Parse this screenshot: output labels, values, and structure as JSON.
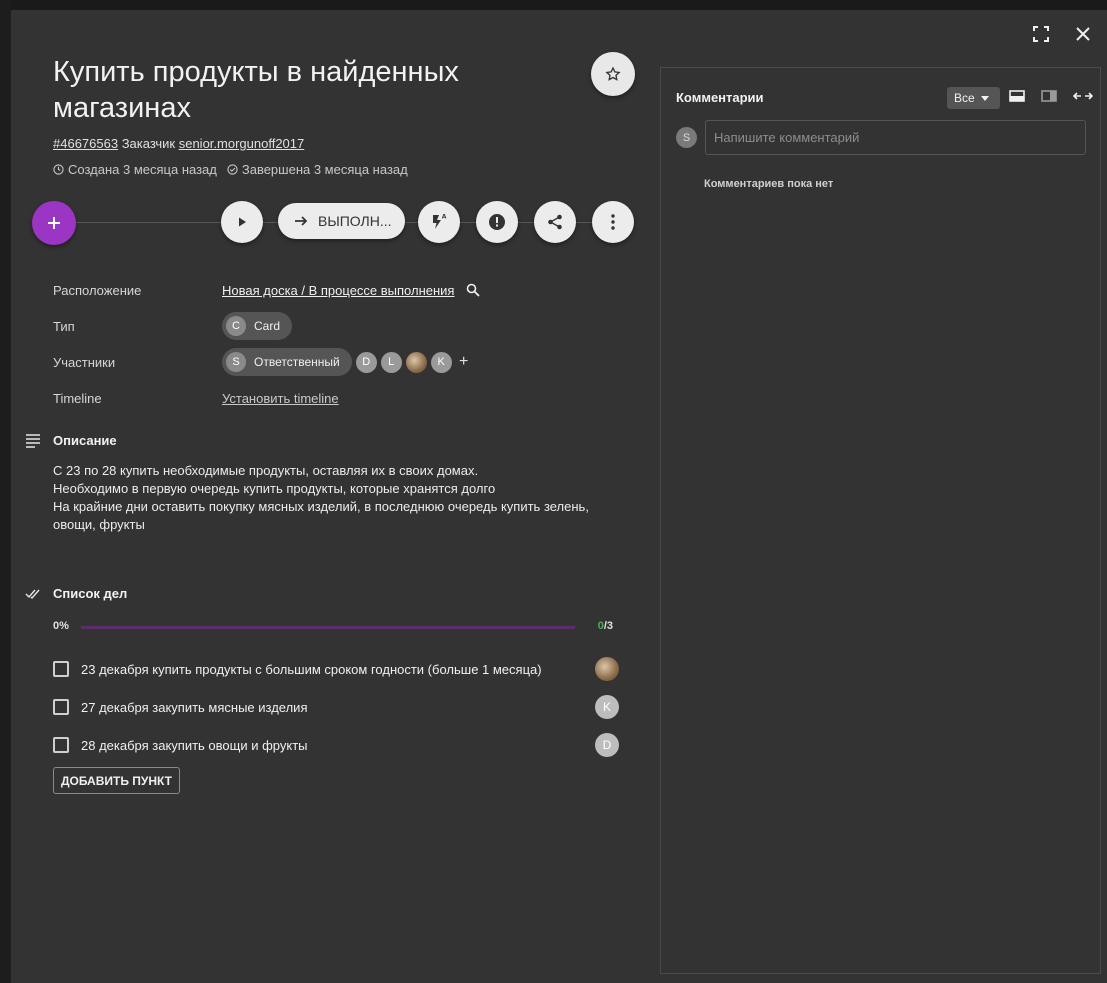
{
  "card": {
    "title": "Купить продукты в найденных магазинах",
    "number": "#46676563",
    "customer_label": "Заказчик",
    "customer": "senior.morgunoff2017",
    "created": "Создана 3 месяца назад",
    "completed": "Завершена 3 месяца назад"
  },
  "actions": {
    "status_label": "ВЫПОЛН..."
  },
  "props": {
    "location_label": "Расположение",
    "location_value": "Новая доска / В процессе выполнения",
    "type_label": "Тип",
    "type_value": "Card",
    "type_avatar": "C",
    "members_label": "Участники",
    "responsible_avatar": "S",
    "responsible_label": "Ответственный",
    "member_avatars": [
      "D",
      "L",
      "K"
    ],
    "timeline_label": "Timeline",
    "timeline_value": "Установить timeline"
  },
  "description": {
    "heading": "Описание",
    "lines": [
      "С 23 по 28 купить необходимые продукты, оставляя их в своих домах.",
      "Необходимо в первую очередь купить продукты, которые хранятся долго",
      "На крайние дни оставить покупку мясных изделий, в последнюю очередь купить зелень, овощи, фрукты"
    ]
  },
  "checklist": {
    "heading": "Список дел",
    "progress_pct": "0%",
    "progress_done": "0",
    "progress_total": "/3",
    "progress_fraction": 0,
    "items": [
      {
        "text": "23 декабря купить продукты с большим сроком годности (больше 1 месяца)",
        "avatar": ""
      },
      {
        "text": "27 декабря закупить мясные изделия",
        "avatar": "K"
      },
      {
        "text": "28 декабря закупить овощи и фрукты",
        "avatar": "D"
      }
    ],
    "add_button": "ДОБАВИТЬ ПУНКТ"
  },
  "comments": {
    "heading": "Комментарии",
    "filter": "Все",
    "user_avatar": "S",
    "placeholder": "Напишите комментарий",
    "empty": "Комментариев пока нет"
  },
  "colors": {
    "accent": "#9b35c4",
    "progress_track": "#5b2e6b",
    "done": "#4caf50"
  }
}
